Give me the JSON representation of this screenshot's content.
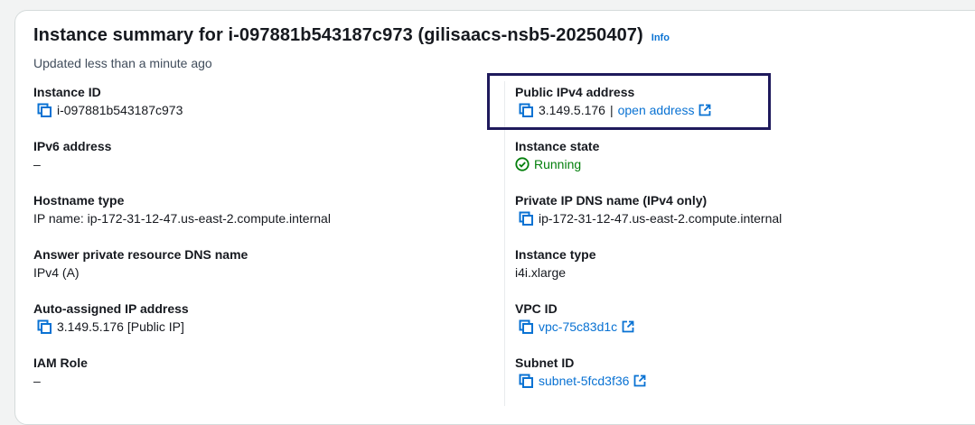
{
  "summary": {
    "title": "Instance summary for i-097881b543187c973 (gilisaacs-nsb5-20250407)",
    "info_label": "Info",
    "updated": "Updated less than a minute ago"
  },
  "left": {
    "instance_id": {
      "label": "Instance ID",
      "value": "i-097881b543187c973"
    },
    "ipv6": {
      "label": "IPv6 address",
      "value": "–"
    },
    "hostname_type": {
      "label": "Hostname type",
      "value": "IP name: ip-172-31-12-47.us-east-2.compute.internal"
    },
    "answer_dns": {
      "label": "Answer private resource DNS name",
      "value": "IPv4 (A)"
    },
    "auto_ip": {
      "label": "Auto-assigned IP address",
      "value": "3.149.5.176 [Public IP]"
    },
    "iam_role": {
      "label": "IAM Role",
      "value": "–"
    }
  },
  "right": {
    "public_ipv4": {
      "label": "Public IPv4 address",
      "value": "3.149.5.176",
      "separator": "|",
      "link": "open address"
    },
    "instance_state": {
      "label": "Instance state",
      "value": "Running"
    },
    "private_dns": {
      "label": "Private IP DNS name (IPv4 only)",
      "value": "ip-172-31-12-47.us-east-2.compute.internal"
    },
    "instance_type": {
      "label": "Instance type",
      "value": "i4i.xlarge"
    },
    "vpc_id": {
      "label": "VPC ID",
      "value": "vpc-75c83d1c"
    },
    "subnet_id": {
      "label": "Subnet ID",
      "value": "subnet-5fcd3f36"
    }
  },
  "colors": {
    "link": "#0972d3",
    "success": "#037f0c",
    "highlight": "#1f1a5c"
  },
  "icons": [
    "copy-icon",
    "external-link-icon",
    "check-circle-icon"
  ]
}
